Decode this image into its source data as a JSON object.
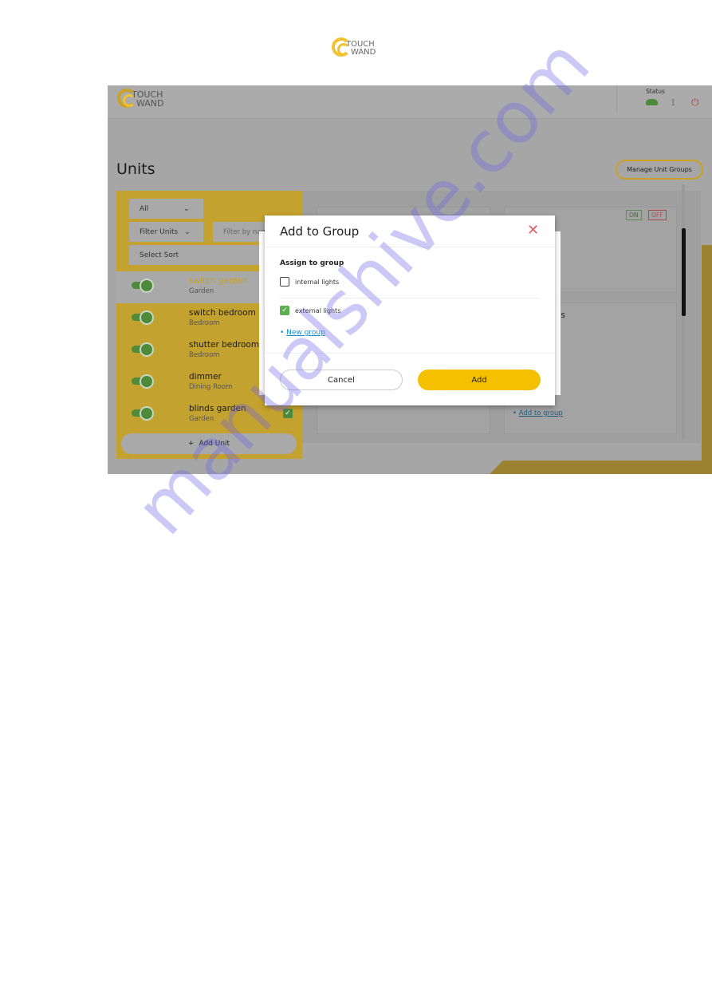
{
  "top_logo": {
    "line1": "TOUCH",
    "line2": "WAND"
  },
  "app": {
    "logo": {
      "line1": "TOUCH",
      "line2": "WAND"
    },
    "status_label": "Status",
    "status_icons": [
      "cloud-icon",
      "lamp-icon",
      "power-icon"
    ],
    "page_title": "Units",
    "manage_groups_label": "Manage Unit Groups",
    "filters": {
      "all": "All",
      "filter_units": "Filter Units",
      "filter_placeholder": "Filter by name",
      "sort": "Select Sort"
    },
    "units": [
      {
        "name": "switch garden",
        "room": "Garden",
        "selected": true
      },
      {
        "name": "switch bedroom",
        "room": "Bedroom"
      },
      {
        "name": "shutter bedroom",
        "room": "Bedroom"
      },
      {
        "name": "dimmer",
        "room": "Dining Room"
      },
      {
        "name": "blinds garden",
        "room": "Garden",
        "checked": true
      }
    ],
    "add_unit_label": "Add Unit",
    "on_label": "ON",
    "off_label": "OFF",
    "groups_heading_partial": "groups",
    "add_to_group_link": "Add to group"
  },
  "dialog": {
    "title": "Add to Group",
    "section_label": "Assign to group",
    "options": [
      {
        "label": "internal lights",
        "checked": false
      },
      {
        "label": "external lights",
        "checked": true
      }
    ],
    "new_group_link": "New group",
    "cancel_label": "Cancel",
    "add_label": "Add"
  },
  "colors": {
    "accent": "#f5c000",
    "check": "#5cae4f",
    "close": "#e06060",
    "link": "#1a8fd0"
  },
  "watermark": "manualshive.com"
}
